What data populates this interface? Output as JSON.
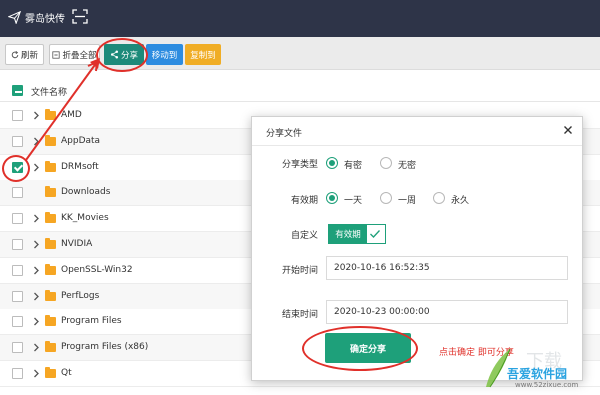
{
  "app": {
    "title": "雾岛快传"
  },
  "toolbar": {
    "refresh": "刷新",
    "collapse_all": "折叠全部",
    "share": "分享",
    "move_to": "移动到",
    "copy_to": "复制到"
  },
  "file_list": {
    "header": "文件名称",
    "rows": [
      {
        "name": "AMD",
        "checked": false,
        "expandable": true
      },
      {
        "name": "AppData",
        "checked": false,
        "expandable": true
      },
      {
        "name": "DRMsoft",
        "checked": true,
        "expandable": true
      },
      {
        "name": "Downloads",
        "checked": false,
        "expandable": false
      },
      {
        "name": "KK_Movies",
        "checked": false,
        "expandable": true
      },
      {
        "name": "NVIDIA",
        "checked": false,
        "expandable": true
      },
      {
        "name": "OpenSSL-Win32",
        "checked": false,
        "expandable": true
      },
      {
        "name": "PerfLogs",
        "checked": false,
        "expandable": true
      },
      {
        "name": "Program Files",
        "checked": false,
        "expandable": true
      },
      {
        "name": "Program Files (x86)",
        "checked": false,
        "expandable": true
      },
      {
        "name": "Qt",
        "checked": false,
        "expandable": true
      }
    ]
  },
  "dialog": {
    "title": "分享文件",
    "share_type": {
      "label": "分享类型",
      "options": [
        "有密",
        "无密"
      ],
      "selected": "有密"
    },
    "validity": {
      "label": "有效期",
      "options": [
        "一天",
        "一周",
        "永久"
      ],
      "selected": "一天"
    },
    "custom": {
      "label": "自定义",
      "toggle_label": "有效期"
    },
    "start_time": {
      "label": "开始时间",
      "value": "2020-10-16 16:52:35"
    },
    "end_time": {
      "label": "结束时间",
      "value": "2020-10-23 00:00:00"
    },
    "confirm": "确定分享"
  },
  "annotation": {
    "note": "点击确定 即可分享"
  },
  "watermark": {
    "name": "吾爱软件园",
    "url": "www.52zixue.com"
  },
  "colors": {
    "accent": "#1ea07a",
    "annotation": "#e0302a",
    "topbar": "#2e3448"
  }
}
